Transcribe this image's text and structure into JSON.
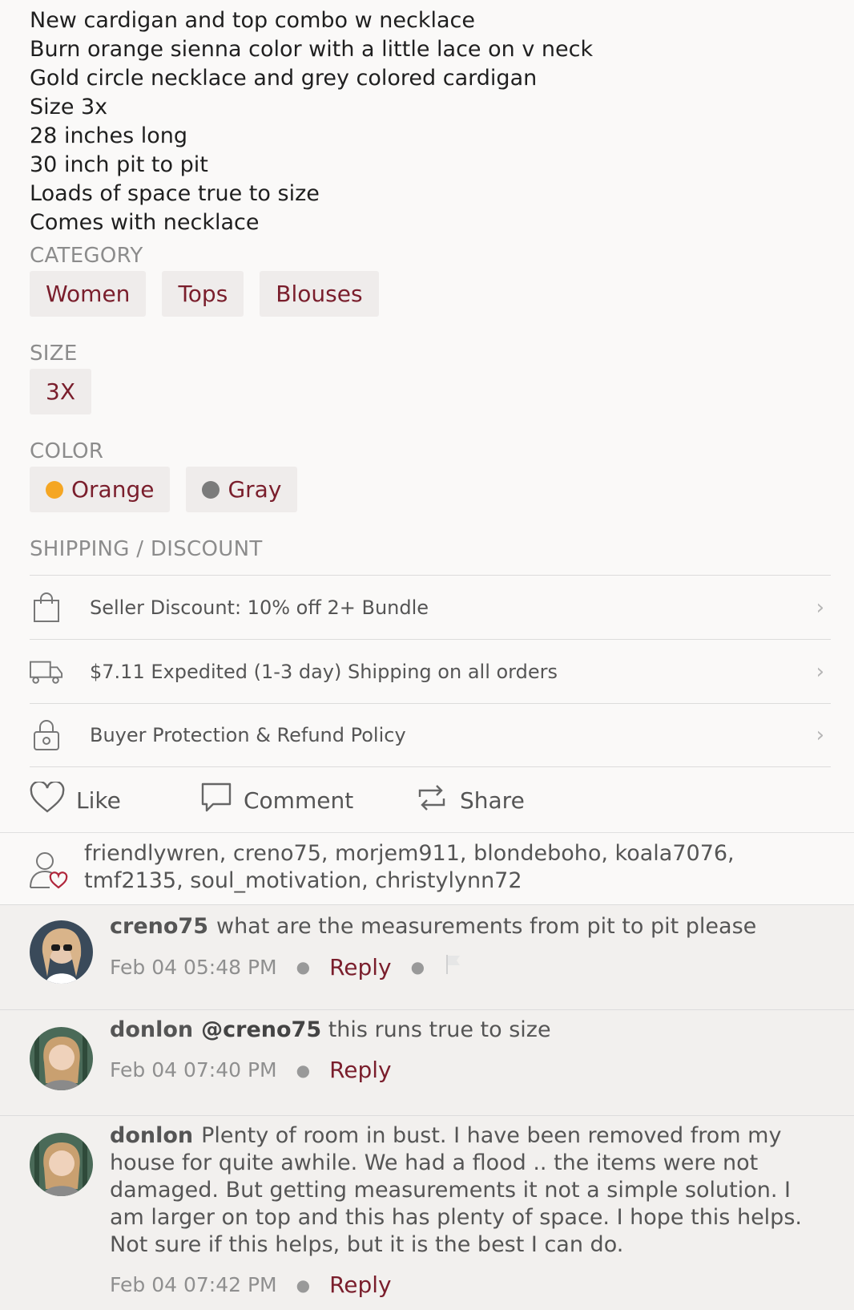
{
  "description": {
    "lines": [
      "New cardigan and top combo w necklace",
      "Burn orange sienna color with a little lace on v neck",
      "Gold circle necklace and grey colored cardigan",
      "Size 3x",
      "28 inches long",
      "30 inch pit to pit",
      "Loads of space true to size",
      "Comes with necklace"
    ]
  },
  "category": {
    "label": "CATEGORY",
    "items": [
      "Women",
      "Tops",
      "Blouses"
    ]
  },
  "size": {
    "label": "SIZE",
    "value": "3X"
  },
  "color": {
    "label": "COLOR",
    "items": [
      {
        "name": "Orange",
        "swatch": "#f5a623"
      },
      {
        "name": "Gray",
        "swatch": "#7b7b7b"
      }
    ]
  },
  "shipping": {
    "label": "SHIPPING / DISCOUNT",
    "rows": [
      {
        "icon": "shopping-bag-icon",
        "text": "Seller Discount: 10% off 2+ Bundle"
      },
      {
        "icon": "delivery-truck-icon",
        "text": "$7.11 Expedited (1-3 day) Shipping on all orders"
      },
      {
        "icon": "padlock-icon",
        "text": "Buyer Protection & Refund Policy"
      }
    ]
  },
  "actions": {
    "like": "Like",
    "comment": "Comment",
    "share": "Share"
  },
  "likers": {
    "text": "friendlywren, creno75, morjem911, blondeboho, koala7076, tmf2135, soul_motivation, christylynn72"
  },
  "comments": [
    {
      "user": "creno75",
      "mention": "",
      "text": "what are the measurements from pit to pit please",
      "time": "Feb 04 05:48 PM",
      "reply": "Reply",
      "flag": true
    },
    {
      "user": "donlon",
      "mention": "@creno75",
      "text": " this runs true to size",
      "time": "Feb 04 07:40 PM",
      "reply": "Reply",
      "flag": false
    },
    {
      "user": "donlon",
      "mention": "",
      "text": "Plenty of room in bust. I have been removed from my house for quite awhile. We had a flood .. the items were not damaged. But getting measurements it not a simple solution. I am larger on top and this has plenty of space. I hope this helps. Not sure if this helps, but it is the best I can do.",
      "time": "Feb 04 07:42 PM",
      "reply": "Reply",
      "flag": false
    }
  ],
  "colors": {
    "accent": "#7a1e2c",
    "chip_bg": "#efeceb",
    "comment_bg": "#f2f0ee"
  }
}
